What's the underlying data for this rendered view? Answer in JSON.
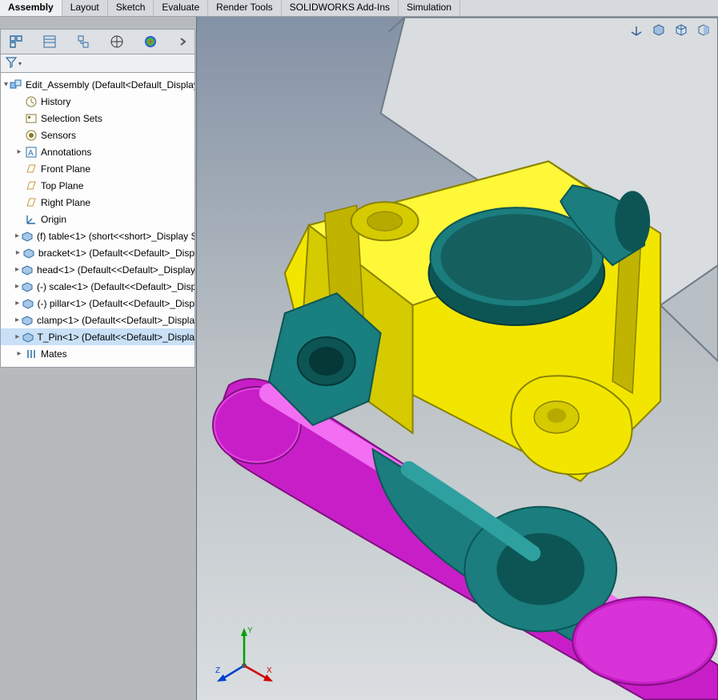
{
  "ribbon": {
    "tabs": [
      "Assembly",
      "Layout",
      "Sketch",
      "Evaluate",
      "Render Tools",
      "SOLIDWORKS Add-Ins",
      "Simulation"
    ],
    "active_index": 0
  },
  "panel": {
    "active_tab": "feature-manager"
  },
  "tree": {
    "root": "Edit_Assembly  (Default<Default_Display S",
    "items": [
      {
        "icon": "history",
        "label": "History",
        "expandable": false
      },
      {
        "icon": "selset",
        "label": "Selection Sets",
        "expandable": false
      },
      {
        "icon": "sensor",
        "label": "Sensors",
        "expandable": false
      },
      {
        "icon": "annot",
        "label": "Annotations",
        "expandable": true
      },
      {
        "icon": "plane",
        "label": "Front Plane",
        "expandable": false
      },
      {
        "icon": "plane",
        "label": "Top Plane",
        "expandable": false
      },
      {
        "icon": "plane",
        "label": "Right Plane",
        "expandable": false
      },
      {
        "icon": "origin",
        "label": "Origin",
        "expandable": false
      },
      {
        "icon": "part",
        "label": "(f) table<1> (short<<short>_Display S",
        "expandable": true
      },
      {
        "icon": "part",
        "label": "bracket<1> (Default<<Default>_Disp",
        "expandable": true
      },
      {
        "icon": "part",
        "label": "head<1> (Default<<Default>_Display",
        "expandable": true
      },
      {
        "icon": "part",
        "label": "(-) scale<1> (Default<<Default>_Disp",
        "expandable": true
      },
      {
        "icon": "part",
        "label": "(-) pillar<1> (Default<<Default>_Disp",
        "expandable": true
      },
      {
        "icon": "part",
        "label": "clamp<1> (Default<<Default>_Displa",
        "expandable": true
      },
      {
        "icon": "part",
        "label": "T_Pin<1> (Default<<Default>_Displa",
        "expandable": true
      },
      {
        "icon": "mates",
        "label": "Mates",
        "expandable": true
      }
    ]
  },
  "triad": {
    "x": "X",
    "y": "Y",
    "z": "Z"
  },
  "colors": {
    "clamp": "#f2e600",
    "clamp_edge": "#aa9e00",
    "cyl": "#c81ec8",
    "cyl_dark": "#8e158e",
    "teal": "#1b7d7d",
    "teal_light": "#2fa0a0",
    "teal_dark": "#0d5555",
    "table": "#d4d8db",
    "table_edge": "#6f7b86"
  }
}
